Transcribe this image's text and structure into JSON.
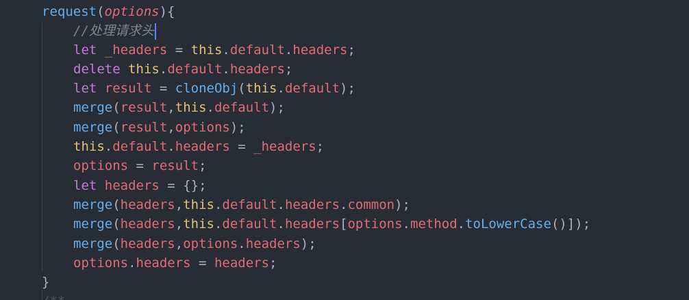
{
  "editor": {
    "function_name": "request",
    "param": "options",
    "comment": "//处理请求头",
    "lines": {
      "l3": {
        "kw": "let",
        "var": "_headers",
        "op": " = ",
        "this": "this",
        "dot1": ".",
        "p1": "default",
        "dot2": ".",
        "p2": "headers",
        "end": ";"
      },
      "l4": {
        "kw": "delete",
        "this": "this",
        "dot1": ".",
        "p1": "default",
        "dot2": ".",
        "p2": "headers",
        "end": ";"
      },
      "l5": {
        "kw": "let",
        "var": "result",
        "op": " = ",
        "fn": "cloneObj",
        "open": "(",
        "this": "this",
        "dot1": ".",
        "p1": "default",
        "close": ");"
      },
      "l6": {
        "fn": "merge",
        "open": "(",
        "a1": "result",
        "comma": ",",
        "this": "this",
        "dot1": ".",
        "p1": "default",
        "close": ");"
      },
      "l7": {
        "fn": "merge",
        "open": "(",
        "a1": "result",
        "comma": ",",
        "a2": "options",
        "close": ");"
      },
      "l8": {
        "this": "this",
        "dot1": ".",
        "p1": "default",
        "dot2": ".",
        "p2": "headers",
        "op": " = ",
        "var": "_headers",
        "end": ";"
      },
      "l9": {
        "var": "options",
        "op": " = ",
        "var2": "result",
        "end": ";"
      },
      "l10": {
        "kw": "let",
        "var": "headers",
        "op": " = ",
        "val": "{}",
        "end": ";"
      },
      "l11": {
        "fn": "merge",
        "open": "(",
        "a1": "headers",
        "comma": ",",
        "this": "this",
        "dot1": ".",
        "p1": "default",
        "dot2": ".",
        "p2": "headers",
        "dot3": ".",
        "p3": "common",
        "close": ");"
      },
      "l12": {
        "fn": "merge",
        "open": "(",
        "a1": "headers",
        "comma": ",",
        "this": "this",
        "dot1": ".",
        "p1": "default",
        "dot2": ".",
        "p2": "headers",
        "br": "[",
        "v1": "options",
        "dot3": ".",
        "p3": "method",
        "dot4": ".",
        "fn2": "toLowerCase",
        "call": "()",
        "close": "]);"
      },
      "l13": {
        "fn": "merge",
        "open": "(",
        "a1": "headers",
        "comma": ",",
        "a2": "options",
        "dot1": ".",
        "p1": "headers",
        "close": ");"
      },
      "l14": {
        "var": "options",
        "dot1": ".",
        "p1": "headers",
        "op": " = ",
        "var2": "headers",
        "end": ";"
      }
    },
    "closing_brace": "}",
    "open_brace": "){",
    "open_paren": "(",
    "partial_next": "/**"
  }
}
